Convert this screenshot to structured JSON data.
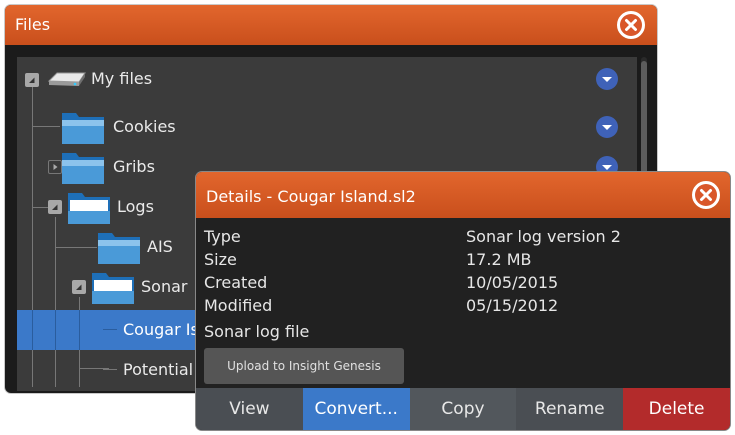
{
  "files_window": {
    "title": "Files"
  },
  "tree": {
    "items": [
      {
        "label": "My files",
        "icon": "drive-icon",
        "expander": "expanded"
      },
      {
        "label": "Cookies",
        "icon": "folder-icon",
        "expander": "none"
      },
      {
        "label": "Gribs",
        "icon": "folder-icon",
        "expander": "collapsed"
      },
      {
        "label": "Logs",
        "icon": "folder-open-icon",
        "expander": "expanded"
      },
      {
        "label": "AIS",
        "icon": "folder-icon",
        "expander": "none"
      },
      {
        "label": "Sonar",
        "icon": "folder-open-icon",
        "expander": "expanded"
      },
      {
        "label": "Cougar Is",
        "icon": "file",
        "selected": true
      },
      {
        "label": "Potential S",
        "icon": "file"
      }
    ]
  },
  "details_window": {
    "title": "Details - Cougar Island.sl2",
    "fields": [
      {
        "key": "Type",
        "value": "Sonar log version 2"
      },
      {
        "key": "Size",
        "value": "17.2 MB"
      },
      {
        "key": "Created",
        "value": "10/05/2015"
      },
      {
        "key": "Modified",
        "value": "05/15/2012"
      }
    ],
    "note": "Sonar log file",
    "upload_label": "Upload to Insight Genesis",
    "buttons": [
      "View",
      "Convert...",
      "Copy",
      "Rename",
      "Delete"
    ]
  },
  "colors": {
    "titlebar": "#d95a24",
    "selection": "#3b79c9",
    "delete": "#b32b2b",
    "dot_button": "#3f62b8"
  }
}
